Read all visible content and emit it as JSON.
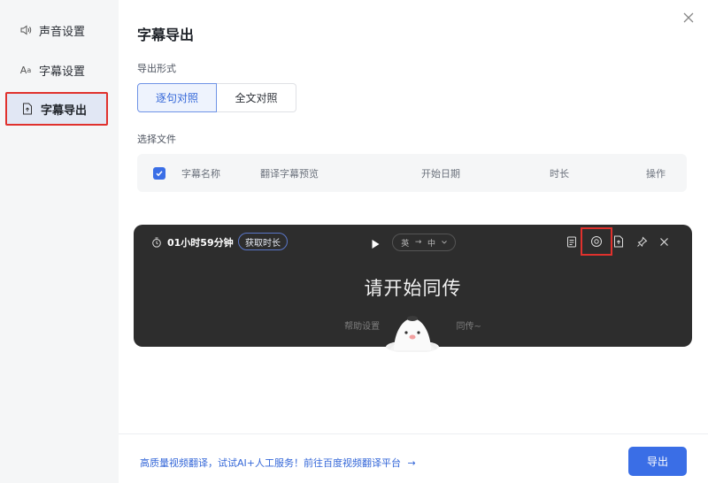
{
  "sidebar": {
    "items": [
      {
        "label": "声音设置",
        "icon": "speaker-icon",
        "active": false
      },
      {
        "label": "字幕设置",
        "icon": "font-icon",
        "active": false
      },
      {
        "label": "字幕导出",
        "icon": "export-file-icon",
        "active": true
      }
    ]
  },
  "main": {
    "title": "字幕导出",
    "export_format_label": "导出形式",
    "formats": [
      {
        "label": "逐句对照",
        "selected": true
      },
      {
        "label": "全文对照",
        "selected": false
      }
    ],
    "select_file_label": "选择文件",
    "table": {
      "headers": [
        "字幕名称",
        "翻译字幕预览",
        "开始日期",
        "时长",
        "操作"
      ]
    }
  },
  "player": {
    "timer": "01小时59分钟",
    "get_duration": "获取时长",
    "lang_from": "英",
    "lang_arrow": "→",
    "lang_to": "中",
    "prompt": "请开始同传",
    "subline_left": "帮助设置",
    "subline_right": "同传~"
  },
  "footer": {
    "promo": "高质量视频翻译，试试AI+人工服务！前往百度视频翻译平台",
    "promo_arrow": "→",
    "export_label": "导出"
  },
  "colors": {
    "accent": "#3a6ee6",
    "highlight": "#e0312d",
    "player_bg": "#2d2d2d"
  }
}
